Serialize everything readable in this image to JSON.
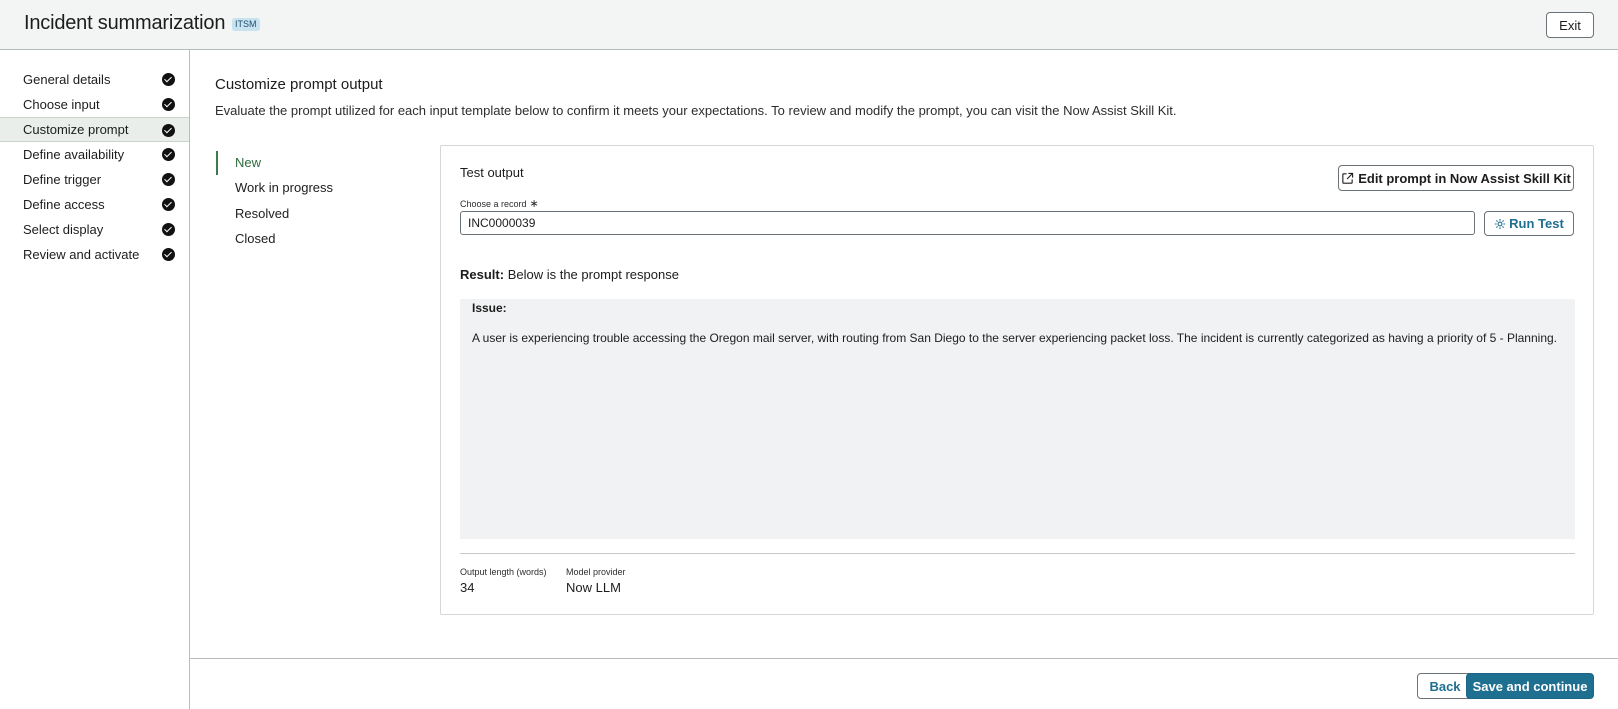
{
  "header": {
    "title": "Incident summarization",
    "badge": "ITSM",
    "exit_label": "Exit"
  },
  "sidebar": {
    "steps": [
      {
        "label": "General details",
        "status": "complete"
      },
      {
        "label": "Choose input",
        "status": "complete"
      },
      {
        "label": "Customize prompt",
        "status": "complete",
        "active": true
      },
      {
        "label": "Define availability",
        "status": "complete"
      },
      {
        "label": "Define trigger",
        "status": "complete"
      },
      {
        "label": "Define access",
        "status": "complete"
      },
      {
        "label": "Select display",
        "status": "complete"
      },
      {
        "label": "Review and activate",
        "status": "complete"
      }
    ]
  },
  "main": {
    "title": "Customize prompt output",
    "description": "Evaluate the prompt utilized for each input template below to confirm it meets your expectations. To review and modify the prompt, you can visit the Now Assist Skill Kit.",
    "tabs": [
      {
        "label": "New",
        "active": true
      },
      {
        "label": "Work in progress"
      },
      {
        "label": "Resolved"
      },
      {
        "label": "Closed"
      }
    ],
    "panel": {
      "title": "Test output",
      "edit_button": "Edit prompt in Now Assist Skill Kit",
      "record_label": "Choose a record",
      "record_required": "∗",
      "record_value": "INC0000039",
      "run_button": "Run Test",
      "result_label": "Result:",
      "result_text": "Below is the prompt response",
      "issue_label": "Issue:",
      "issue_text": "A user is experiencing trouble accessing the Oregon mail server, with routing from San Diego to the server experiencing packet loss. The incident is currently categorized as having a priority of 5 - Planning.",
      "output_length_label": "Output length (words)",
      "output_length_value": "34",
      "model_provider_label": "Model provider",
      "model_provider_value": "Now LLM"
    }
  },
  "footer": {
    "back_label": "Back",
    "save_label": "Save and continue"
  },
  "colors": {
    "primary": "#1f6f91",
    "active_tab": "#2f6b3f",
    "header_bg": "#f3f4f4"
  }
}
